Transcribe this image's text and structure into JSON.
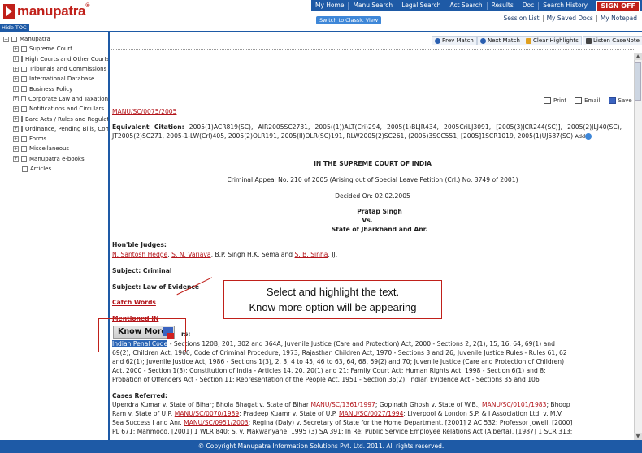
{
  "header": {
    "logo_text": "manupatra",
    "logo_mark": "®",
    "nav": [
      "My Home",
      "Manu Search",
      "Legal Search",
      "Act Search",
      "Results",
      "Doc",
      "Search History"
    ],
    "signoff": "SIGN OFF",
    "classic_view": "Switch to Classic View",
    "session": [
      "Session List",
      "My Saved Docs",
      "My Notepad"
    ]
  },
  "sidebar": {
    "hide_toc": "Hide TOC",
    "root": "Manupatra",
    "items": [
      {
        "label": "Supreme Court",
        "expandable": true
      },
      {
        "label": "High Courts and Other Courts",
        "expandable": true
      },
      {
        "label": "Tribunals and Commissions",
        "expandable": true
      },
      {
        "label": "International Database",
        "expandable": true
      },
      {
        "label": "Business Policy",
        "expandable": true
      },
      {
        "label": "Corporate Law and Taxation",
        "expandable": true
      },
      {
        "label": "Notifications and Circulars",
        "expandable": true
      },
      {
        "label": "Bare Acts / Rules and Regulations",
        "expandable": true
      },
      {
        "label": "Ordinance, Pending Bills, Committee Reports",
        "expandable": true
      },
      {
        "label": "Forms",
        "expandable": true
      },
      {
        "label": "Miscellaneous",
        "expandable": true
      },
      {
        "label": "Manupatra e-books",
        "expandable": true
      },
      {
        "label": "Articles",
        "expandable": false
      }
    ]
  },
  "toolbar": {
    "prev": "Prev Match",
    "next": "Next Match",
    "clear": "Clear Highlights",
    "listen": "Listen CaseNote"
  },
  "doc": {
    "citation_id": "MANU/SC/0075/2005",
    "print": "Print",
    "email": "Email",
    "save": "Save",
    "equiv_label": "Equivalent Citation:",
    "equiv_text": "2005(1)ACR819(SC), AIR2005SC2731, 2005((1))ALT(Cri)294, 2005(1)BLJR434, 2005CriLJ3091, [2005(3)JCR244(SC)], 2005(2)JLJ40(SC), JT2005(2)SC271, 2005-1-LW(Crl)405, 2005(2)OLR191, 2005(II)OLR(SC)191, RLW2005(2)SC261, (2005)3SCC551, [2005]1SCR1019, 2005(1)UJ587(SC)",
    "add": "Add",
    "court": "IN THE SUPREME COURT OF INDIA",
    "appeal": "Criminal Appeal No. 210 of 2005 (Arising out of Special Leave Petition (Crl.) No. 3749 of 2001)",
    "decided": "Decided On: 02.02.2005",
    "party1": "Pratap Singh",
    "vs": "Vs.",
    "party2": "State of Jharkhand and Anr.",
    "judges_label": "Hon'ble Judges:",
    "judge1": "N. Santosh Hedge",
    "judge2": "S. N. Variava",
    "judge_mid": ", B.P. Singh H.K. Sema and",
    "judge3": "S. B. Sinha",
    "judge_tail": ", JJ.",
    "subject1": "Subject: Criminal",
    "subject2": "Subject: Law of Evidence",
    "catch_words": "Catch Words",
    "mentioned_in": "Mentioned IN",
    "acts_tail": "rs:",
    "highlight": "Indian Penal Code",
    "acts_line1": " - Sections 120B, 201, 302 and 364A; Juvenile Justice (Care and Protection) Act, 2000 - Sections 2, 2(1), 15, 16, 64, 69(1) and",
    "acts_line2": "69(2); Children Act, 1960; Code of Criminal Procedure, 1973; Rajasthan Children Act, 1970 - Sections 3 and 26; Juvenile Justice Rules - Rules 61, 62",
    "acts_line3": "and 62(1); Juvenile Justice Act, 1986 - Sections 1(3), 2, 3, 4 to 45, 46 to 63, 64, 68, 69(2) and 70; Juvenile Justice (Care and Protection of Children)",
    "acts_line4": "Act, 2000 - Section 1(3); Constitution of India - Articles 14, 20, 20(1) and 21; Family Court Act; Human Rights Act, 1998 - Section 6(1) and 8;",
    "acts_line5": "Probation of Offenders Act - Section 11; Representation of the People Act, 1951 - Section 36(2); Indian Evidence Act - Sections 35 and 106",
    "cases_label": "Cases Referred:",
    "cases_l1a": "Upendra Kumar v. State of Bihar; Bhola Bhagat v. State of Bihar",
    "cases_l1b": "MANU/SC/1361/1997",
    "cases_l1c": "; Gopinath Ghosh v. State of W.B.,",
    "cases_l1d": "MANU/SC/0101/1983",
    "cases_l1e": "; Bhoop",
    "cases_l2a": "Ram v. State of U.P.",
    "cases_l2b": "MANU/SC/0070/1989",
    "cases_l2c": "; Pradeep Kuamr v. State of U.P.",
    "cases_l2d": "MANU/SC/0027/1994",
    "cases_l2e": "; Liverpool & London S.P. & I Association Ltd. v. M.V.",
    "cases_l3a": "Sea Success I and Anr.",
    "cases_l3b": "MANU/SC/0951/2003",
    "cases_l3c": "; Regina (Daly) v. Secretary of State for the Home Department, [2001] 2 AC 532; Professor Jowell, [2000]",
    "cases_l4": "PL 671; Mahmood, [2001] 1 WLR 840; S. v. Makwanyane, 1995 (3) SA 391; In Re: Public Service Employee Relations Act (Alberta), [1987] 1 SCR 313;"
  },
  "callout": {
    "line1": "Select and highlight the text.",
    "line2": "Know more option will be appearing"
  },
  "know_more": "Know More",
  "footer": "© Copyright Manupatra Information Solutions Pvt. Ltd. 2011. All rights reserved."
}
